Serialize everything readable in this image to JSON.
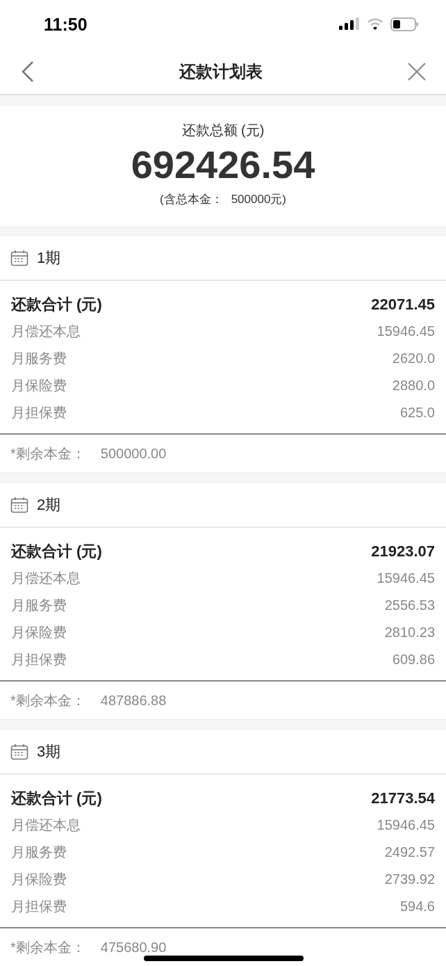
{
  "status_bar": {
    "time": "11:50"
  },
  "nav": {
    "title": "还款计划表"
  },
  "summary": {
    "label": "还款总额 (元)",
    "amount": "692426.54",
    "note_label": "(含总本金：",
    "note_value": "500000元)"
  },
  "periods": [
    {
      "title": "1期",
      "total_label": "还款合计 (元)",
      "total": "22071.45",
      "rows": [
        {
          "label": "月偿还本息",
          "value": "15946.45"
        },
        {
          "label": "月服务费",
          "value": "2620.0"
        },
        {
          "label": "月保险费",
          "value": "2880.0"
        },
        {
          "label": "月担保费",
          "value": "625.0"
        }
      ],
      "remaining_label": "*剩余本金：",
      "remaining": "500000.00"
    },
    {
      "title": "2期",
      "total_label": "还款合计 (元)",
      "total": "21923.07",
      "rows": [
        {
          "label": "月偿还本息",
          "value": "15946.45"
        },
        {
          "label": "月服务费",
          "value": "2556.53"
        },
        {
          "label": "月保险费",
          "value": "2810.23"
        },
        {
          "label": "月担保费",
          "value": "609.86"
        }
      ],
      "remaining_label": "*剩余本金：",
      "remaining": "487886.88"
    },
    {
      "title": "3期",
      "total_label": "还款合计 (元)",
      "total": "21773.54",
      "rows": [
        {
          "label": "月偿还本息",
          "value": "15946.45"
        },
        {
          "label": "月服务费",
          "value": "2492.57"
        },
        {
          "label": "月保险费",
          "value": "2739.92"
        },
        {
          "label": "月担保费",
          "value": "594.6"
        }
      ],
      "remaining_label": "*剩余本金：",
      "remaining": "475680.90"
    }
  ]
}
